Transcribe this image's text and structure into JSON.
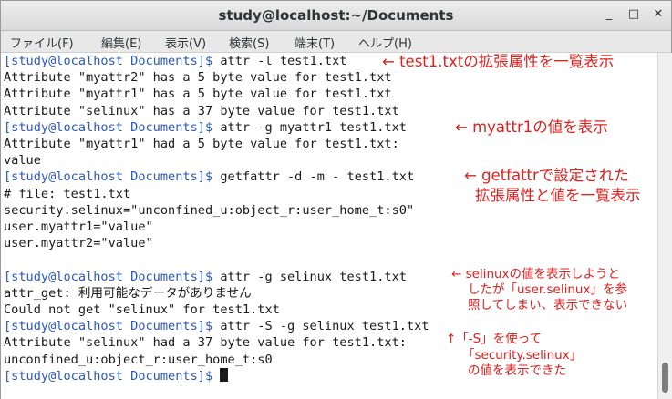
{
  "window": {
    "title": "study@localhost:~/Documents",
    "buttons": {
      "minimize": "_",
      "maximize": "□",
      "close": "✕"
    }
  },
  "menu": [
    "ファイル(F)",
    "編集(E)",
    "表示(V)",
    "検索(S)",
    "端末(T)",
    "ヘルプ(H)"
  ],
  "terminal": {
    "prompt": "[study@localhost Documents]$",
    "lines": [
      {
        "type": "cmd",
        "text": " attr -l test1.txt"
      },
      {
        "type": "out",
        "text": "Attribute \"myattr2\" has a 5 byte value for test1.txt"
      },
      {
        "type": "out",
        "text": "Attribute \"myattr1\" has a 5 byte value for test1.txt"
      },
      {
        "type": "out",
        "text": "Attribute \"selinux\" has a 37 byte value for test1.txt"
      },
      {
        "type": "cmd",
        "text": " attr -g myattr1 test1.txt"
      },
      {
        "type": "out",
        "text": "Attribute \"myattr1\" had a 5 byte value for test1.txt:"
      },
      {
        "type": "out",
        "text": "value"
      },
      {
        "type": "cmd",
        "text": " getfattr -d -m - test1.txt"
      },
      {
        "type": "out",
        "text": "# file: test1.txt"
      },
      {
        "type": "out",
        "text": "security.selinux=\"unconfined_u:object_r:user_home_t:s0\""
      },
      {
        "type": "out",
        "text": "user.myattr1=\"value\""
      },
      {
        "type": "out",
        "text": "user.myattr2=\"value\""
      },
      {
        "type": "out",
        "text": ""
      },
      {
        "type": "cmd",
        "text": " attr -g selinux test1.txt"
      },
      {
        "type": "out",
        "text": "attr_get: 利用可能なデータがありません"
      },
      {
        "type": "out",
        "text": "Could not get \"selinux\" for test1.txt"
      },
      {
        "type": "cmd",
        "text": " attr -S -g selinux test1.txt"
      },
      {
        "type": "out",
        "text": "Attribute \"selinux\" had a 37 byte value for test1.txt:"
      },
      {
        "type": "out",
        "text": "unconfined_u:object_r:user_home_t:s0"
      },
      {
        "type": "cursor",
        "text": " "
      }
    ]
  },
  "annotations": [
    {
      "text": "← test1.txtの拡張属性を一覧表示",
      "size": "big"
    },
    {
      "text": "← myattr1の値を表示",
      "size": "big"
    },
    {
      "text": "← getfattrで設定された",
      "size": "big"
    },
    {
      "text": "拡張属性と値を一覧表示",
      "size": "big"
    },
    {
      "text": "← selinuxの値を表示しようと",
      "size": "small"
    },
    {
      "text": "したが「user.selinux」を参",
      "size": "small"
    },
    {
      "text": "照してしまい、表示できない",
      "size": "small"
    },
    {
      "text": "↑「-S」を使って",
      "size": "small"
    },
    {
      "text": "「security.selinux」",
      "size": "small"
    },
    {
      "text": "の値を表示できた",
      "size": "small"
    }
  ],
  "colors": {
    "prompt": "#2b57c4",
    "annotation": "#e0201e",
    "text": "#1a1a1a"
  }
}
